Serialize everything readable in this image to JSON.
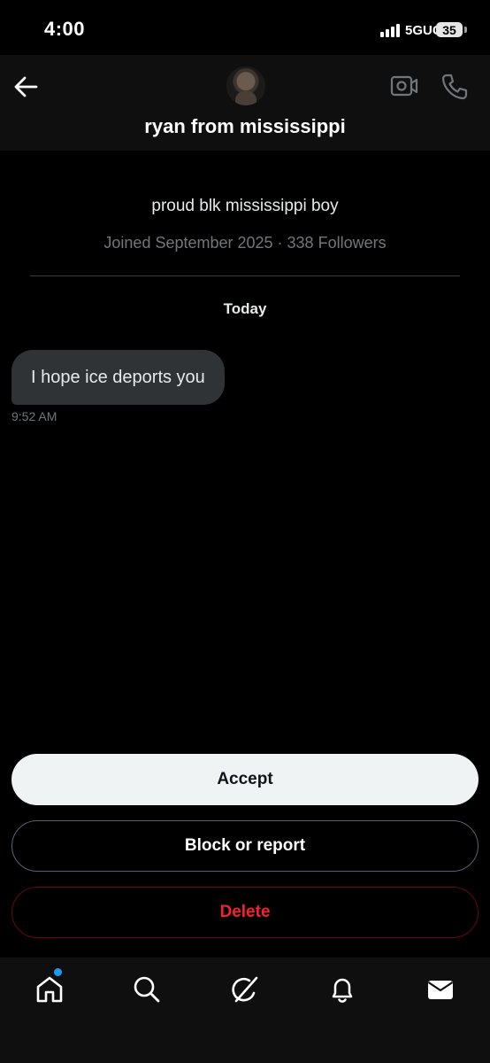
{
  "status_bar": {
    "time": "4:00",
    "network": "5GUC",
    "battery": "35"
  },
  "header": {
    "title": "ryan from mississippi",
    "back_icon": "arrow-left-icon",
    "avatar_icon": "avatar-photo",
    "video_icon": "video-call-icon",
    "phone_icon": "phone-icon"
  },
  "profile": {
    "bio": "proud blk mississippi boy",
    "meta": "Joined September 2025 · 338 Followers"
  },
  "conversation": {
    "day_label": "Today",
    "messages": [
      {
        "text": "I hope ice deports you",
        "time": "9:52 AM"
      }
    ]
  },
  "actions": {
    "accept": "Accept",
    "block_report": "Block or report",
    "delete": "Delete"
  },
  "bottom_nav": {
    "items": [
      "home-icon",
      "search-icon",
      "grok-icon",
      "notifications-icon",
      "messages-icon"
    ],
    "has_unread_dot": true
  },
  "colors": {
    "background": "#000000",
    "bubble": "#2f3336",
    "muted_text": "#71767b",
    "delete_red": "#f4212e",
    "accent_blue": "#1d9bf0"
  }
}
